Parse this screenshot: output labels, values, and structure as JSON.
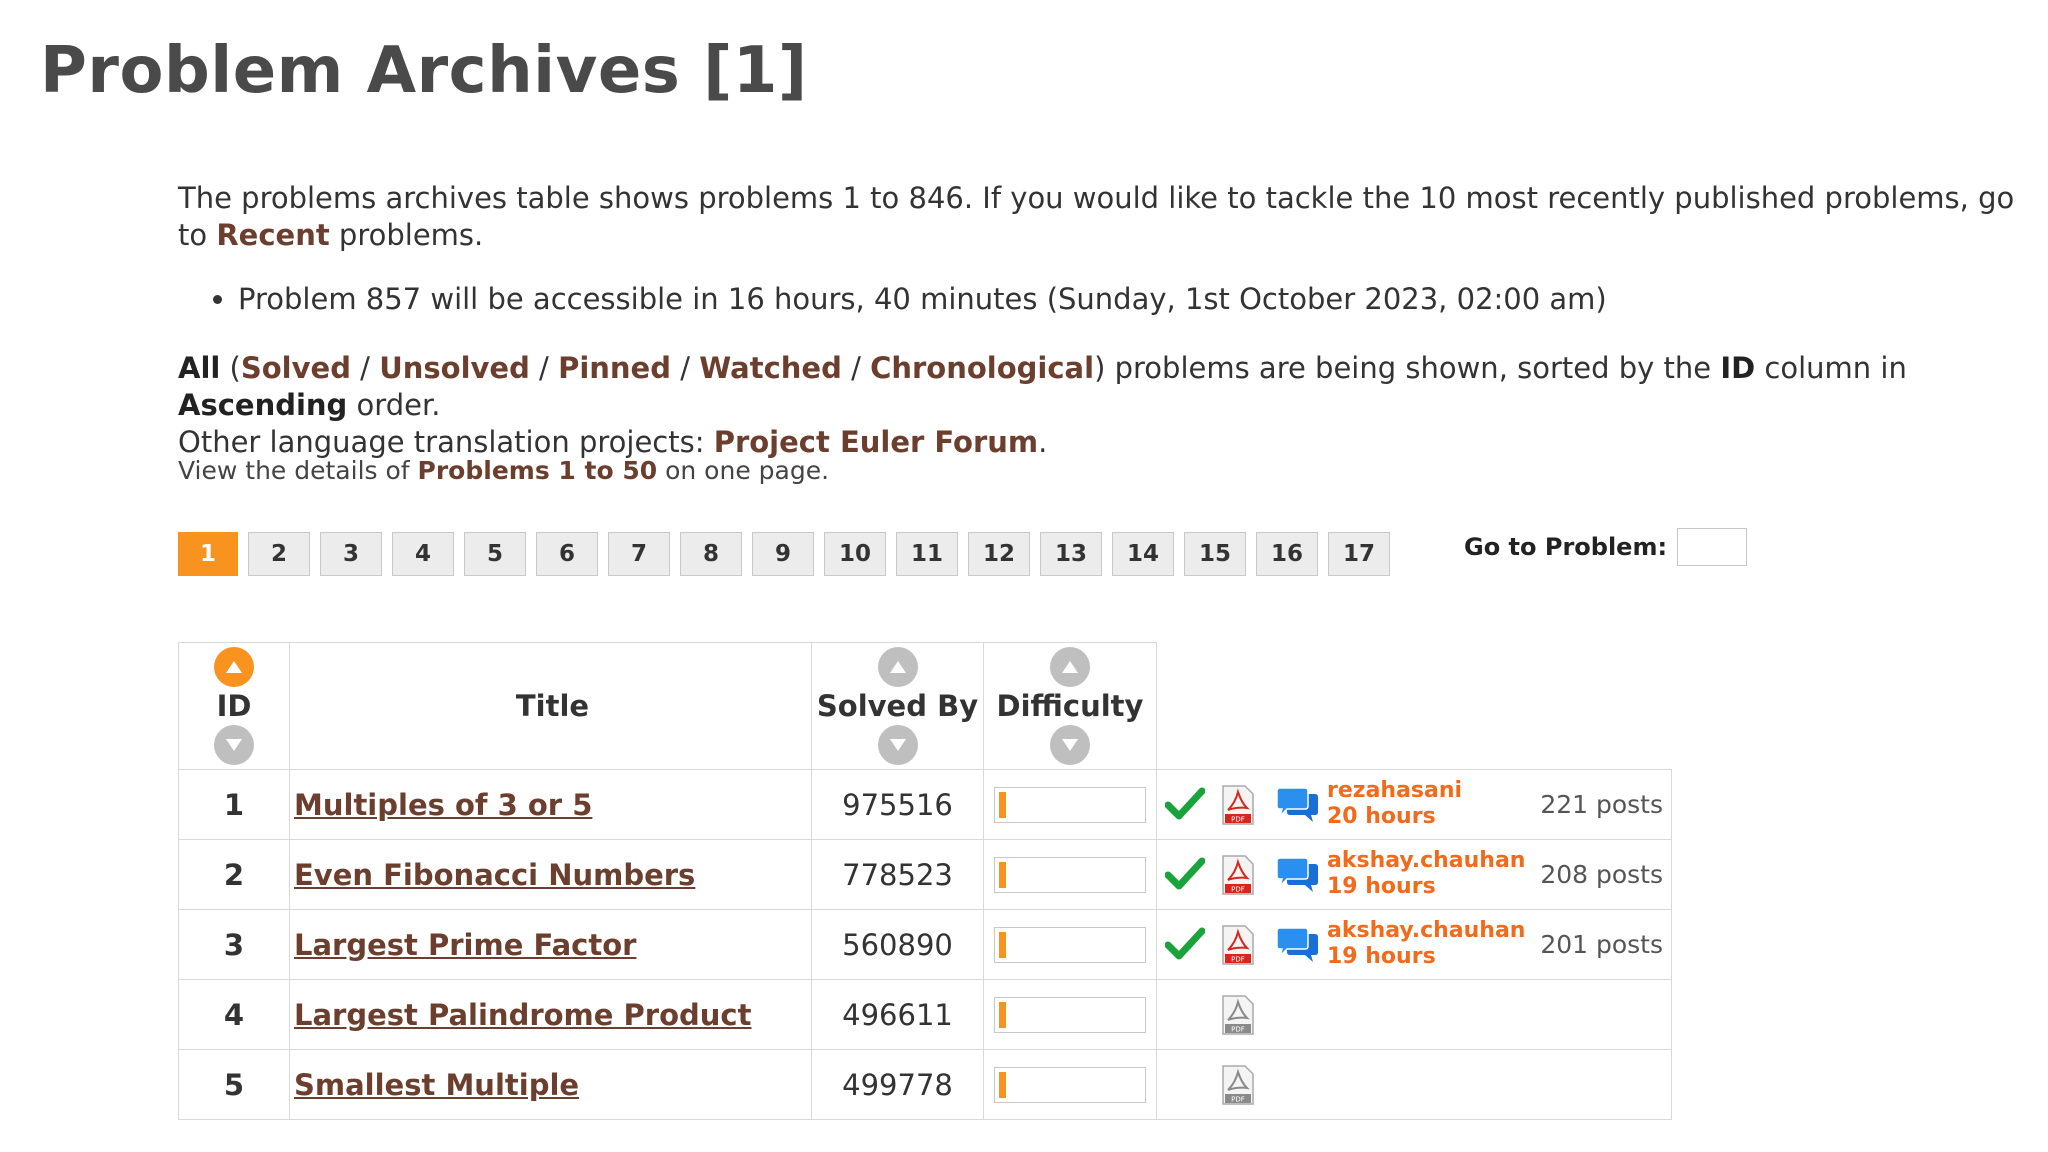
{
  "page_title": "Problem Archives [1]",
  "intro": {
    "text_before": "The problems archives table shows problems 1 to 846. If you would like to tackle the 10 most recently published problems, go to ",
    "link": "Recent",
    "text_after": " problems."
  },
  "notice": "Problem 857 will be accessible in 16 hours, 40 minutes (Sunday, 1st October 2023, 02:00 am)",
  "filter": {
    "all": "All",
    "open_paren": " (",
    "solved": "Solved",
    "unsolved": "Unsolved",
    "pinned": "Pinned",
    "watched": "Watched",
    "chronological": "Chronological",
    "sep": " / ",
    "shown_text": ") problems are being shown, sorted by the ",
    "sort_column": "ID",
    "column_in": " column in ",
    "sort_order": "Ascending",
    "order_text": " order.",
    "translation_text": "Other language translation projects: ",
    "translation_link": "Project Euler Forum",
    "period": "."
  },
  "details": {
    "prefix": "View the details of ",
    "link": "Problems 1 to 50",
    "suffix": " on one page."
  },
  "pager": {
    "pages": [
      "1",
      "2",
      "3",
      "4",
      "5",
      "6",
      "7",
      "8",
      "9",
      "10",
      "11",
      "12",
      "13",
      "14",
      "15",
      "16",
      "17"
    ],
    "active": "1",
    "goto_label": "Go to Problem:"
  },
  "table": {
    "headers": {
      "id": "ID",
      "title": "Title",
      "solved_by": "Solved By",
      "difficulty": "Difficulty"
    },
    "rows": [
      {
        "id": "1",
        "title": "Multiples of 3 or 5",
        "solved_by": "975516",
        "difficulty": 0.05,
        "solved": true,
        "pdf": "pdf-red-icon",
        "forum_user": "rezahasani",
        "forum_time": "20 hours",
        "posts": "221 posts"
      },
      {
        "id": "2",
        "title": "Even Fibonacci Numbers",
        "solved_by": "778523",
        "difficulty": 0.05,
        "solved": true,
        "pdf": "pdf-red-icon",
        "forum_user": "akshay.chauhan",
        "forum_time": "19 hours",
        "posts": "208 posts"
      },
      {
        "id": "3",
        "title": "Largest Prime Factor",
        "solved_by": "560890",
        "difficulty": 0.05,
        "solved": true,
        "pdf": "pdf-red-icon",
        "forum_user": "akshay.chauhan",
        "forum_time": "19 hours",
        "posts": "201 posts"
      },
      {
        "id": "4",
        "title": "Largest Palindrome Product",
        "solved_by": "496611",
        "difficulty": 0.05,
        "solved": false,
        "pdf": "pdf-gray-icon",
        "forum_user": "",
        "forum_time": "",
        "posts": ""
      },
      {
        "id": "5",
        "title": "Smallest Multiple",
        "solved_by": "499778",
        "difficulty": 0.05,
        "solved": false,
        "pdf": "pdf-gray-icon",
        "forum_user": "",
        "forum_time": "",
        "posts": ""
      }
    ]
  },
  "colors": {
    "accent": "#f7931e",
    "link": "#6b3e2e",
    "forum_user": "#f26a1b",
    "check": "#1aa33a"
  }
}
